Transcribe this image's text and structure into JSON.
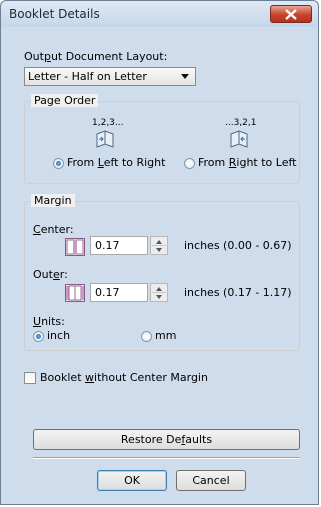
{
  "window": {
    "title": "Booklet Details"
  },
  "layout": {
    "label_prefix": "Out",
    "label_mnemonic": "p",
    "label_suffix": "ut Document Layout:",
    "selected": "Letter - Half on Letter"
  },
  "page_order": {
    "group_title": "Page Order",
    "ltr_sequence": "1,2,3...",
    "rtl_sequence": "...3,2,1",
    "ltr_prefix": "From ",
    "ltr_mnemonic": "L",
    "ltr_suffix": "eft to Right",
    "rtl_prefix": "From ",
    "rtl_mnemonic": "R",
    "rtl_suffix": "ight to Left",
    "selected": "ltr"
  },
  "margin": {
    "group_title": "Margin",
    "center_mnemonic": "C",
    "center_suffix": "enter:",
    "center_value": "0.17",
    "center_range": "inches (0.00 - 0.67)",
    "outer_prefix": "Out",
    "outer_mnemonic": "e",
    "outer_suffix": "r:",
    "outer_value": "0.17",
    "outer_range": "inches (0.17 - 1.17)",
    "units_mnemonic": "U",
    "units_suffix": "nits:",
    "unit_inch": "inch",
    "unit_mm": "mm",
    "selected_unit": "inch"
  },
  "no_center_margin": {
    "prefix": "Booklet ",
    "mnemonic": "w",
    "suffix": "ithout Center Margin",
    "checked": false
  },
  "buttons": {
    "restore_prefix": "Restore De",
    "restore_mnemonic": "f",
    "restore_suffix": "aults",
    "ok": "OK",
    "cancel": "Cancel"
  },
  "icons": {
    "close": "close-x-icon",
    "booklet": "booklet-icon",
    "center_margin": "center-margin-icon",
    "outer_margin": "outer-margin-icon"
  },
  "colors": {
    "close_button": "#c8432c",
    "radio_selected": "#1e5fa8",
    "title_bar": "#cfdcec"
  }
}
